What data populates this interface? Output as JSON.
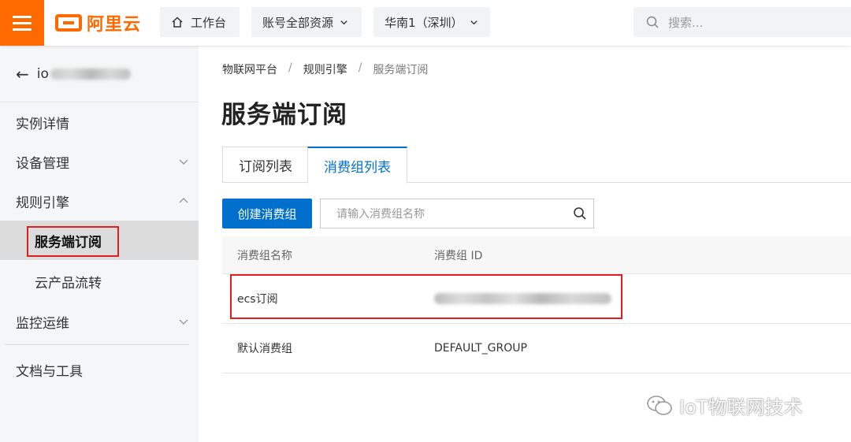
{
  "topbar": {
    "logo_text": "阿里云",
    "workbench": "工作台",
    "resources": "账号全部资源",
    "region": "华南1（深圳）",
    "search_placeholder": "搜索..."
  },
  "sidebar": {
    "back_label": "io",
    "items": [
      {
        "label": "实例详情"
      },
      {
        "label": "设备管理"
      },
      {
        "label": "规则引擎"
      },
      {
        "label": "服务端订阅"
      },
      {
        "label": "云产品流转"
      },
      {
        "label": "监控运维"
      },
      {
        "label": "文档与工具"
      }
    ]
  },
  "breadcrumb": [
    "物联网平台",
    "规则引擎",
    "服务端订阅"
  ],
  "page_title": "服务端订阅",
  "tabs": [
    "订阅列表",
    "消费组列表"
  ],
  "toolbar": {
    "create_label": "创建消费组",
    "search_placeholder": "请输入消费组名称"
  },
  "table": {
    "columns": [
      "消费组名称",
      "消费组 ID"
    ],
    "rows": [
      {
        "name": "ecs订阅",
        "id": ""
      },
      {
        "name": "默认消费组",
        "id": "DEFAULT_GROUP"
      }
    ]
  },
  "watermark": "IoT物联网技术",
  "colors": {
    "brand": "#ff6a00",
    "primary": "#0070cc",
    "highlight": "#e02020"
  }
}
